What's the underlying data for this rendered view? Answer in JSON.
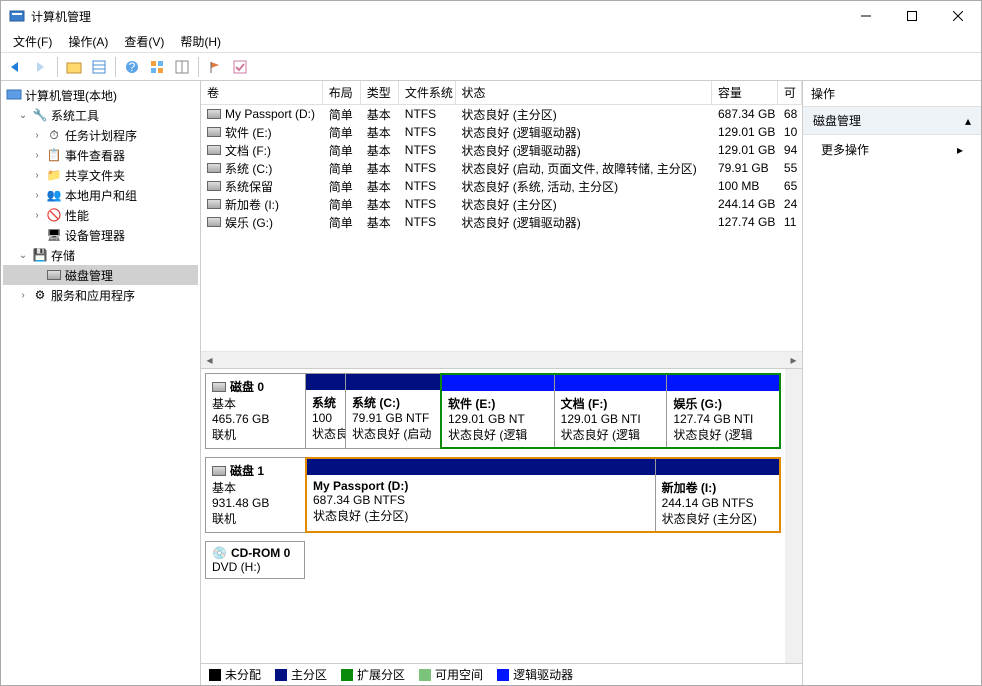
{
  "window": {
    "title": "计算机管理"
  },
  "menu": {
    "file": "文件(F)",
    "action": "操作(A)",
    "view": "查看(V)",
    "help": "帮助(H)"
  },
  "tree": {
    "root": "计算机管理(本地)",
    "systools": "系统工具",
    "sched": "任务计划程序",
    "event": "事件查看器",
    "shared": "共享文件夹",
    "users": "本地用户和组",
    "perf": "性能",
    "devmgr": "设备管理器",
    "storage": "存储",
    "diskmgmt": "磁盘管理",
    "services": "服务和应用程序"
  },
  "cols": {
    "vol": "卷",
    "layout": "布局",
    "type": "类型",
    "fs": "文件系统",
    "status": "状态",
    "capacity": "容量",
    "avail": "可"
  },
  "volumes": [
    {
      "name": "My Passport (D:)",
      "layout": "简单",
      "type": "基本",
      "fs": "NTFS",
      "status": "状态良好 (主分区)",
      "capacity": "687.34 GB",
      "avail": "68"
    },
    {
      "name": "软件 (E:)",
      "layout": "简单",
      "type": "基本",
      "fs": "NTFS",
      "status": "状态良好 (逻辑驱动器)",
      "capacity": "129.01 GB",
      "avail": "10"
    },
    {
      "name": "文档 (F:)",
      "layout": "简单",
      "type": "基本",
      "fs": "NTFS",
      "status": "状态良好 (逻辑驱动器)",
      "capacity": "129.01 GB",
      "avail": "94"
    },
    {
      "name": "系统 (C:)",
      "layout": "简单",
      "type": "基本",
      "fs": "NTFS",
      "status": "状态良好 (启动, 页面文件, 故障转储, 主分区)",
      "capacity": "79.91 GB",
      "avail": "55"
    },
    {
      "name": "系统保留",
      "layout": "简单",
      "type": "基本",
      "fs": "NTFS",
      "status": "状态良好 (系统, 活动, 主分区)",
      "capacity": "100 MB",
      "avail": "65"
    },
    {
      "name": "新加卷 (I:)",
      "layout": "简单",
      "type": "基本",
      "fs": "NTFS",
      "status": "状态良好 (主分区)",
      "capacity": "244.14 GB",
      "avail": "24"
    },
    {
      "name": "娱乐 (G:)",
      "layout": "简单",
      "type": "基本",
      "fs": "NTFS",
      "status": "状态良好 (逻辑驱动器)",
      "capacity": "127.74 GB",
      "avail": "11"
    }
  ],
  "disk0": {
    "name": "磁盘 0",
    "type": "基本",
    "size": "465.76 GB",
    "status": "联机",
    "p0_name": "系统",
    "p0_size": "100",
    "p0_stat": "状态良好",
    "p1_name": "系统  (C:)",
    "p1_size": "79.91 GB NTF",
    "p1_stat": "状态良好 (启动",
    "p2_name": "软件  (E:)",
    "p2_size": "129.01 GB NT",
    "p2_stat": "状态良好 (逻辑",
    "p3_name": "文档  (F:)",
    "p3_size": "129.01 GB NTI",
    "p3_stat": "状态良好 (逻辑",
    "p4_name": "娱乐  (G:)",
    "p4_size": "127.74 GB NTI",
    "p4_stat": "状态良好 (逻辑"
  },
  "disk1": {
    "name": "磁盘 1",
    "type": "基本",
    "size": "931.48 GB",
    "status": "联机",
    "p0_name": "My Passport  (D:)",
    "p0_size": "687.34 GB NTFS",
    "p0_stat": "状态良好 (主分区)",
    "p1_name": "新加卷  (I:)",
    "p1_size": "244.14 GB NTFS",
    "p1_stat": "状态良好 (主分区)"
  },
  "cdrom": {
    "name": "CD-ROM 0",
    "sub": "DVD (H:)"
  },
  "legend": {
    "unalloc": "未分配",
    "primary": "主分区",
    "ext": "扩展分区",
    "free": "可用空间",
    "logical": "逻辑驱动器"
  },
  "actions": {
    "header": "操作",
    "section": "磁盘管理",
    "more": "更多操作"
  }
}
